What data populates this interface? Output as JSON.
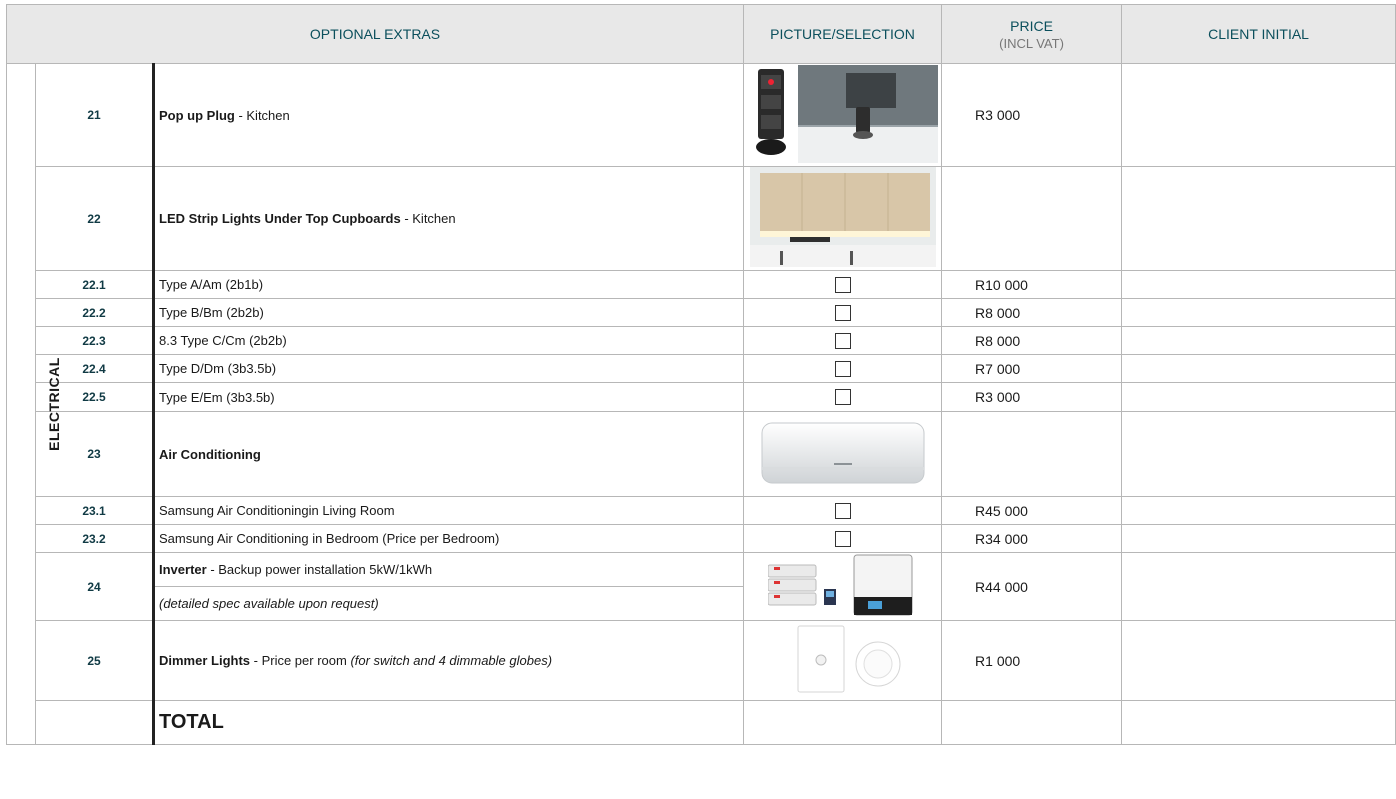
{
  "headers": {
    "optional_extras": "OPTIONAL EXTRAS",
    "picture_selection": "PICTURE/SELECTION",
    "price": "PRICE",
    "price_sub": "(INCL VAT)",
    "client_initial": "CLIENT INITIAL"
  },
  "category": "ELECTRICAL",
  "rows": {
    "r21": {
      "num": "21",
      "title": "Pop up Plug",
      "suffix": " - Kitchen",
      "price": "R3 000",
      "picture": "pop-up-plug-photo"
    },
    "r22": {
      "num": "22",
      "title": "LED Strip Lights Under Top Cupboards",
      "suffix": " - Kitchen",
      "price": "",
      "picture": "led-strip-kitchen-photo"
    },
    "r22_1": {
      "num": "22.1",
      "text": "Type A/Am (2b1b)",
      "price": "R10 000"
    },
    "r22_2": {
      "num": "22.2",
      "text": "Type B/Bm (2b2b)",
      "price": "R8 000"
    },
    "r22_3": {
      "num": "22.3",
      "text": "8.3 Type C/Cm (2b2b)",
      "price": "R8 000"
    },
    "r22_4": {
      "num": "22.4",
      "text": "Type D/Dm (3b3.5b)",
      "price": "R7 000"
    },
    "r22_5": {
      "num": "22.5",
      "text": "Type E/Em (3b3.5b)",
      "price": "R3 000"
    },
    "r23": {
      "num": "23",
      "title": "Air Conditioning",
      "price": "",
      "picture": "air-conditioner-photo"
    },
    "r23_1": {
      "num": "23.1",
      "text": "Samsung Air Conditioningin Living Room",
      "price": "R45 000"
    },
    "r23_2": {
      "num": "23.2",
      "text": "Samsung Air Conditioning in Bedroom (Price per Bedroom)",
      "price": "R34 000"
    },
    "r24": {
      "num": "24",
      "title": "Inverter",
      "suffix": " - Backup power installation 5kW/1kWh",
      "note": "(detailed spec available upon request)",
      "price": "R44 000",
      "picture": "inverter-battery-photo"
    },
    "r25": {
      "num": "25",
      "title": "Dimmer Lights",
      "suffix": " -  Price per room ",
      "note": "(for switch and 4 dimmable globes)",
      "price": "R1 000",
      "picture": "dimmer-switch-photo"
    }
  },
  "total_label": "TOTAL"
}
